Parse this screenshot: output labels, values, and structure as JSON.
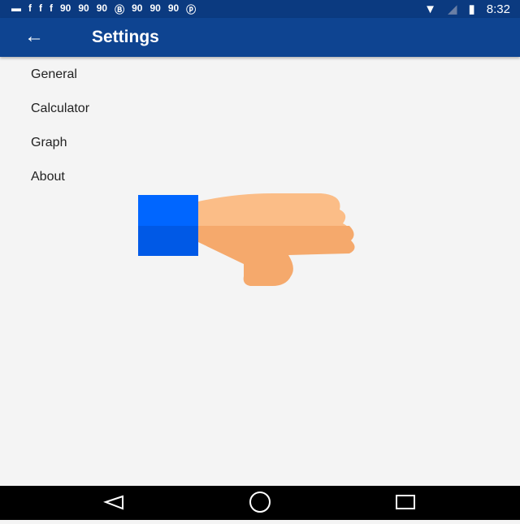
{
  "status_bar": {
    "time": "8:32",
    "notification_icons": [
      "message-icon",
      "facebook-icon",
      "facebook-icon",
      "facebook-icon",
      "link-icon",
      "link-icon",
      "link-icon",
      "bbm-icon",
      "link-icon",
      "link-icon",
      "link-icon",
      "pinterest-icon"
    ]
  },
  "app_bar": {
    "title": "Settings",
    "back_icon": "arrow-left-icon"
  },
  "settings": {
    "items": [
      {
        "label": "General"
      },
      {
        "label": "Calculator"
      },
      {
        "label": "Graph"
      },
      {
        "label": "About"
      }
    ]
  },
  "overlay": {
    "icon": "thumbs-down-icon",
    "colors": {
      "cuff": "#0066ff",
      "hand": "#fbbd87"
    }
  },
  "nav_bar": {
    "buttons": [
      "back",
      "home",
      "recents"
    ]
  }
}
